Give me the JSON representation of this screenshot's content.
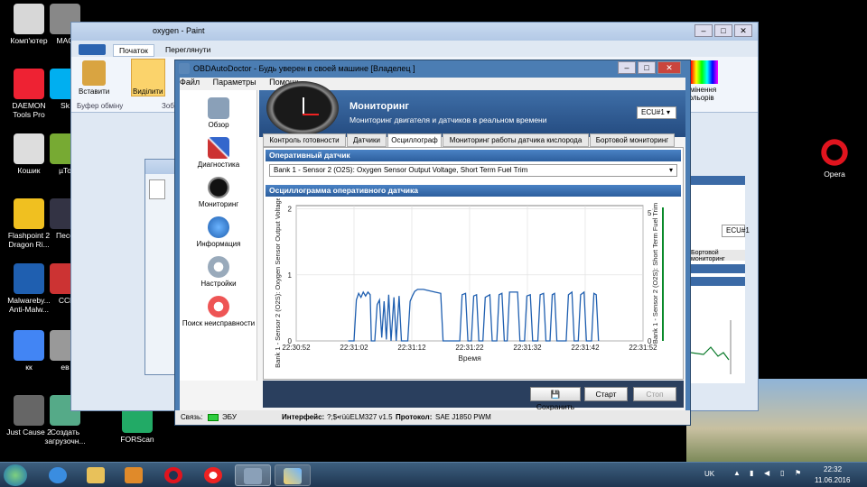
{
  "desktop": {
    "icons_left": [
      {
        "label": "Комп'ютер",
        "name": "computer-icon"
      },
      {
        "label": "DAEMON Tools Pro",
        "name": "daemon-tools-icon"
      },
      {
        "label": "Кошик",
        "name": "recycle-bin-icon"
      },
      {
        "label": "Flashpoint 2 Dragon Ri...",
        "name": "flashpoint-icon"
      },
      {
        "label": "Malwareby... Anti-Malw...",
        "name": "malwarebytes-icon"
      },
      {
        "label": "кк",
        "name": "chrome-icon"
      },
      {
        "label": "Just Cause 2",
        "name": "just-cause-icon"
      }
    ],
    "icons_col2": [
      {
        "label": "MAC",
        "name": "mac-icon"
      },
      {
        "label": "Sk",
        "name": "skype-icon"
      },
      {
        "label": "µTo",
        "name": "utorrent-icon"
      },
      {
        "label": "Песо",
        "name": "pes-icon"
      },
      {
        "label": "CCl",
        "name": "ccleaner-icon"
      },
      {
        "label": "ев",
        "name": "misc-icon"
      },
      {
        "label": "Создать загрузочн...",
        "name": "create-boot-icon"
      }
    ],
    "icons_col3": [
      {
        "label": "Комп'ютер",
        "name": "computer-icon-2"
      },
      {
        "label": "DAEMON Tools Pro",
        "name": "daemon-tools-icon-2"
      },
      {
        "label": "Кошик",
        "name": "recycle-bin-icon-2"
      },
      {
        "label": "Flashpoint 2 Dragon Ri...",
        "name": "flashpoint-icon-2"
      }
    ],
    "icons_col4": [
      {
        "label": "MAC",
        "name": "mac-icon-2"
      },
      {
        "label": "Sk",
        "name": "skype-icon-2"
      },
      {
        "label": "µTo",
        "name": "utorrent-icon-2"
      },
      {
        "label": "Песо",
        "name": "pes-icon-2"
      },
      {
        "label": "FORScan",
        "name": "forscan-icon"
      }
    ],
    "opera_label": "Opera"
  },
  "paint": {
    "title": "oxygen - Paint",
    "tabs": [
      "Початок",
      "Переглянути"
    ],
    "paste_label": "Вставити",
    "select_label": "Виділити",
    "clipboard_label": "Буфер обміну",
    "zoom_label": "Зоб",
    "colors_label": "Змінення кольорів"
  },
  "obd": {
    "title": "OBDAutoDoctor - Будь уверен в своей машине [Владелец ]",
    "menu": [
      "Файл",
      "Параметры",
      "Помощь"
    ],
    "sidebar": [
      "Обзор",
      "Диагностика",
      "Мониторинг",
      "Информация",
      "Настройки",
      "Поиск неисправности"
    ],
    "header_title": "Мониторинг",
    "header_subtitle": "Мониторинг двигателя и датчиков в реальном времени",
    "ecu": "ECU#1",
    "tabs": [
      "Контроль готовности",
      "Датчики",
      "Осциллограф",
      "Мониторинг работы датчика кислорода",
      "Бортовой мониторинг"
    ],
    "sensor_panel": "Оперативный датчик",
    "sensor_value": "Bank 1 - Sensor 2 (O2S): Oxygen Sensor Output Voltage, Short Term Fuel Trim",
    "scope_panel": "Осциллограмма оперативного датчика",
    "buttons": {
      "save": "Сохранить",
      "start": "Старт",
      "stop": "Стоп"
    },
    "status": {
      "link_label": "Связь:",
      "link_value": "ЭБУ",
      "iface_label": "Интерфейс:",
      "iface_value": "?;$•rüüELM327 v1.5",
      "proto_label": "Протокол:",
      "proto_value": "SAE J1850 PWM"
    }
  },
  "behind_window": {
    "ecu": "ECU#1",
    "tab": "Бортовой мониторинг"
  },
  "taskbar": {
    "lang": "UK",
    "time": "22:32",
    "date": "11.06.2016"
  },
  "chart_data": {
    "type": "line",
    "xlabel": "Время",
    "ylabel": "Bank 1 - Sensor 2 (O2S): Oxygen Sensor Output Voltage",
    "y2label": "Bank 1 - Sensor 2 (O2S): Short Term Fuel Trim",
    "x_ticks": [
      "22:30:52",
      "22:31:02",
      "22:31:12",
      "22:31:22",
      "22:31:32",
      "22:31:42",
      "22:31:52"
    ],
    "y_ticks": [
      "0",
      "1",
      "2"
    ],
    "y2_ticks": [
      "0",
      "5"
    ],
    "ylim": [
      0,
      2.05
    ],
    "xlim": [
      0,
      60
    ],
    "grid": true,
    "series": [
      {
        "color": "#1f5fb0",
        "points": [
          [
            9,
            0
          ],
          [
            10,
            0
          ],
          [
            10.4,
            0.62
          ],
          [
            10.8,
            0.72
          ],
          [
            11.2,
            0.66
          ],
          [
            11.6,
            0.74
          ],
          [
            12,
            0.68
          ],
          [
            12.4,
            0.74
          ],
          [
            12.8,
            0.7
          ],
          [
            13,
            0
          ],
          [
            13.6,
            0
          ],
          [
            14,
            0.55
          ],
          [
            14.4,
            0.62
          ],
          [
            14.8,
            0.05
          ],
          [
            15.2,
            0.6
          ],
          [
            15.6,
            0.02
          ],
          [
            16,
            0.7
          ],
          [
            16.4,
            0
          ],
          [
            16.9,
            0.66
          ],
          [
            17.3,
            0
          ],
          [
            17.8,
            0.68
          ],
          [
            18.2,
            0
          ],
          [
            19.3,
            0
          ],
          [
            19.7,
            0.6
          ],
          [
            20.1,
            0.68
          ],
          [
            20.5,
            0.75
          ],
          [
            21,
            0.78
          ],
          [
            22,
            0.78
          ],
          [
            23,
            0.76
          ],
          [
            24,
            0.74
          ],
          [
            25,
            0.72
          ],
          [
            25.4,
            0
          ],
          [
            28.3,
            0
          ],
          [
            28.7,
            0.7
          ],
          [
            29.3,
            0.72
          ],
          [
            29.7,
            0
          ],
          [
            30.3,
            0
          ],
          [
            30.7,
            0.68
          ],
          [
            31.2,
            0.7
          ],
          [
            31.6,
            0
          ],
          [
            32.3,
            0
          ],
          [
            32.7,
            0.66
          ],
          [
            33.5,
            0.7
          ],
          [
            33.9,
            0
          ],
          [
            34.7,
            0
          ],
          [
            35.1,
            0.7
          ],
          [
            35.6,
            0.72
          ],
          [
            36,
            0
          ],
          [
            36.5,
            0
          ],
          [
            36.9,
            0.74
          ],
          [
            38.3,
            0.74
          ],
          [
            38.7,
            0
          ],
          [
            39.5,
            0
          ],
          [
            39.9,
            0.68
          ],
          [
            40.5,
            0.7
          ],
          [
            40.9,
            0
          ],
          [
            41.8,
            0
          ],
          [
            42.2,
            0.7
          ],
          [
            42.8,
            0.72
          ],
          [
            43.2,
            0
          ],
          [
            43.9,
            0
          ],
          [
            44.3,
            0.7
          ],
          [
            44.7,
            0.72
          ],
          [
            45.1,
            0
          ],
          [
            46.7,
            0
          ],
          [
            47.1,
            0.7
          ],
          [
            47.7,
            0.74
          ],
          [
            48.1,
            0
          ],
          [
            48.8,
            0
          ],
          [
            49.2,
            0.7
          ],
          [
            49.8,
            0.74
          ],
          [
            50.2,
            0
          ],
          [
            51.1,
            0
          ],
          [
            51.5,
            0.72
          ],
          [
            51.9,
            0.7
          ],
          [
            52.3,
            0
          ]
        ]
      }
    ]
  }
}
